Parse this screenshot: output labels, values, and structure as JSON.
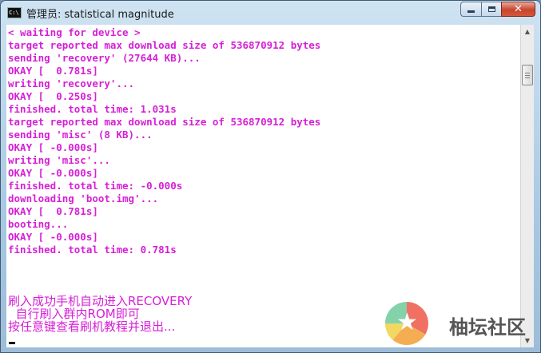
{
  "window": {
    "icon_label": "C:\\",
    "title": "管理员: statistical magnitude",
    "buttons": {
      "minimize": "",
      "maximize": "",
      "close": "✕"
    }
  },
  "console": {
    "lines": [
      "< waiting for device >",
      "target reported max download size of 536870912 bytes",
      "sending 'recovery' (27644 KB)...",
      "OKAY [  0.781s]",
      "writing 'recovery'...",
      "OKAY [  0.250s]",
      "finished. total time: 1.031s",
      "target reported max download size of 536870912 bytes",
      "sending 'misc' (8 KB)...",
      "OKAY [ -0.000s]",
      "writing 'misc'...",
      "OKAY [ -0.000s]",
      "finished. total time: -0.000s",
      "downloading 'boot.img'...",
      "OKAY [  0.781s]",
      "booting...",
      "OKAY [ -0.000s]",
      "finished. total time: 0.781s"
    ],
    "messages": [
      "刷入成功手机自动进入RECOVERY",
      "  自行刷入群内ROM即可",
      "按任意键查看刷机教程并退出..."
    ]
  },
  "scrollbar": {
    "up": "▲",
    "down": "▼"
  },
  "watermark": {
    "star": "★",
    "text": "柚坛社区"
  },
  "colors": {
    "console_text": "#d61fd6",
    "console_bg": "#ffffff",
    "frame": "#a9c8e2"
  }
}
